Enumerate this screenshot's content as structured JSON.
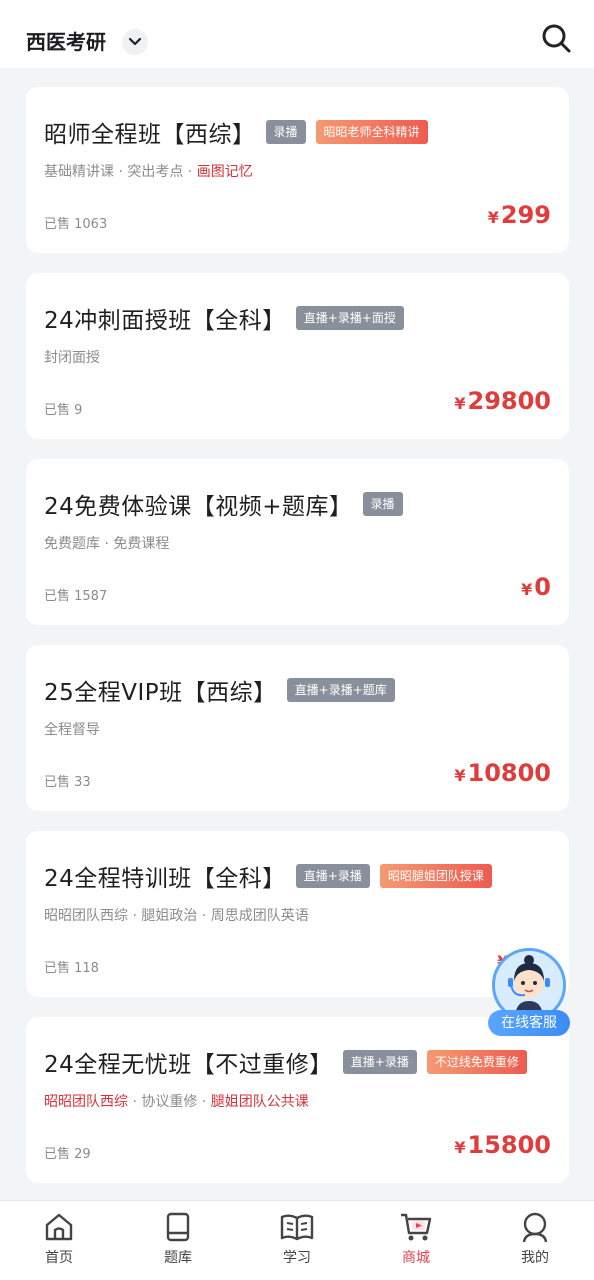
{
  "header": {
    "category": "西医考研",
    "category_icon": "chevron-down-icon",
    "search_icon": "search-icon"
  },
  "courses": [
    {
      "title": "昭师全程班【西综】",
      "tags": [
        {
          "text": "录播",
          "style": "gray"
        },
        {
          "text": "昭昭老师全科精讲",
          "style": "orange"
        }
      ],
      "subtitle_parts": [
        {
          "text": "基础精讲课 · 突出考点 · ",
          "highlight": false
        },
        {
          "text": "画图记忆",
          "highlight": true
        }
      ],
      "sold": "已售 1063",
      "currency": "¥",
      "price": "299"
    },
    {
      "title": "24冲刺面授班【全科】",
      "tags": [
        {
          "text": "直播+录播+面授",
          "style": "gray"
        }
      ],
      "subtitle_parts": [
        {
          "text": "封闭面授",
          "highlight": false
        }
      ],
      "sold": "已售 9",
      "currency": "¥",
      "price": "29800"
    },
    {
      "title": "24免费体验课【视频+题库】",
      "tags": [
        {
          "text": "录播",
          "style": "gray"
        }
      ],
      "subtitle_parts": [
        {
          "text": "免费题库 · 免费课程",
          "highlight": false
        }
      ],
      "sold": "已售 1587",
      "currency": "¥",
      "price": "0"
    },
    {
      "title": "25全程VIP班【西综】",
      "tags": [
        {
          "text": "直播+录播+题库",
          "style": "gray"
        }
      ],
      "subtitle_parts": [
        {
          "text": "全程督导",
          "highlight": false
        }
      ],
      "sold": "已售 33",
      "currency": "¥",
      "price": "10800"
    },
    {
      "title": "24全程特训班【全科】",
      "tags": [
        {
          "text": "直播+录播",
          "style": "gray"
        },
        {
          "text": "昭昭腿姐团队授课",
          "style": "orange"
        }
      ],
      "subtitle_parts": [
        {
          "text": "昭昭团队西综 · 腿姐政治 · 周思成团队英语",
          "highlight": false
        }
      ],
      "sold": "已售 118",
      "currency": "¥",
      "price": "4…"
    },
    {
      "title": "24全程无忧班【不过重修】",
      "tags": [
        {
          "text": "直播+录播",
          "style": "gray"
        },
        {
          "text": "不过线免费重修",
          "style": "orange"
        }
      ],
      "subtitle_parts": [
        {
          "text": "昭昭团队西综",
          "highlight": true
        },
        {
          "text": " · 协议重修 · ",
          "highlight": false
        },
        {
          "text": "腿姐团队公共课",
          "highlight": true
        }
      ],
      "sold": "已售 29",
      "currency": "¥",
      "price": "15800"
    }
  ],
  "service": {
    "label": "在线客服",
    "icon": "customer-service-avatar-icon"
  },
  "tabbar": [
    {
      "label": "首页",
      "icon": "home-icon",
      "active": false
    },
    {
      "label": "题库",
      "icon": "book-icon",
      "active": false
    },
    {
      "label": "学习",
      "icon": "open-book-icon",
      "active": false
    },
    {
      "label": "商城",
      "icon": "shopping-cart-icon",
      "active": true
    },
    {
      "label": "我的",
      "icon": "user-icon",
      "active": false
    }
  ],
  "colors": {
    "accent_red": "#e03c3c",
    "tag_gray": "#8a8f9c",
    "tag_orange": "#ee5b50",
    "service_blue": "#3b8cf5"
  }
}
